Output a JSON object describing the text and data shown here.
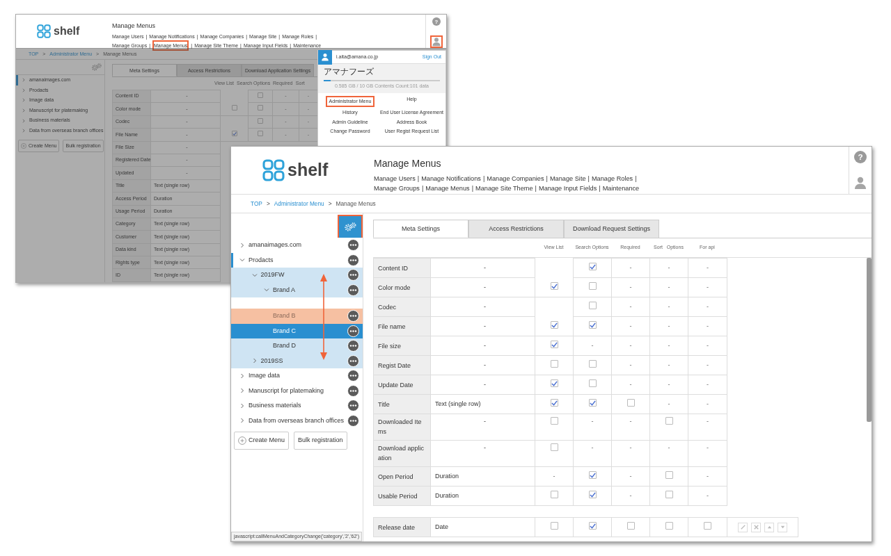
{
  "back_window": {
    "logo": "shelf",
    "title": "Manage Menus",
    "help_label": "?",
    "user_button": {
      "highlighted": true
    },
    "separator": "|",
    "nav_lines": [
      [
        {
          "label": "Manage Users",
          "highlighted": false
        },
        {
          "label": "Manage Notifications",
          "highlighted": false
        },
        {
          "label": "Manage Companies",
          "highlighted": false
        },
        {
          "label": "Manage Site",
          "highlighted": false
        },
        {
          "label": "Manage Roles",
          "highlighted": false
        }
      ],
      [
        {
          "label": "Manage Groups",
          "highlighted": false
        },
        {
          "label": "Manage Menus",
          "highlighted": true
        },
        {
          "label": "Manage Site Theme",
          "highlighted": false
        },
        {
          "label": "Manage Input Fields",
          "highlighted": false
        },
        {
          "label": "Maintenance",
          "highlighted": false
        }
      ]
    ],
    "breadcrumb_separator": ">",
    "breadcrumb": [
      {
        "label": "TOP",
        "link": true
      },
      {
        "label": "Administrator Menu",
        "link": true
      },
      {
        "label": "Manage Menus",
        "link": false
      }
    ],
    "dimmed": true,
    "tree": [
      {
        "label": "amanaimages.com",
        "selected": true
      },
      {
        "label": "Prodacts",
        "selected": false
      },
      {
        "label": "Image data",
        "selected": false
      },
      {
        "label": "Manuscript for platemaking",
        "selected": false
      },
      {
        "label": "Business materials",
        "selected": false
      },
      {
        "label": "Data from overseas branch offices",
        "selected": false
      }
    ],
    "buttons": [
      {
        "label": "Create Menu",
        "kind": "add"
      },
      {
        "label": "Bulk registration",
        "kind": "plain"
      }
    ],
    "tabs": [
      {
        "label": "Meta Settings",
        "selected": true
      },
      {
        "label": "Access Restrictions",
        "selected": false
      },
      {
        "label": "Download Application Settings",
        "selected": false
      }
    ],
    "columns": [
      "View List",
      "Search Options",
      "Required",
      "Sort"
    ],
    "rows": [
      {
        "label": "Content ID",
        "type": "-",
        "cells": [
          {
            "kind": "empty"
          },
          {
            "kind": "check",
            "checked": false
          },
          {
            "kind": "dash",
            "text": "-"
          },
          {
            "kind": "dash",
            "text": "-"
          }
        ]
      },
      {
        "label": "Color mode",
        "type": "-",
        "cells": [
          {
            "kind": "check",
            "checked": false
          },
          {
            "kind": "check",
            "checked": false
          },
          {
            "kind": "dash",
            "text": "-"
          },
          {
            "kind": "dash",
            "text": "-"
          }
        ]
      },
      {
        "label": "Codec",
        "type": "-",
        "cells": [
          {
            "kind": "empty"
          },
          {
            "kind": "check",
            "checked": false
          },
          {
            "kind": "dash",
            "text": "-"
          },
          {
            "kind": "dash",
            "text": "-"
          }
        ]
      },
      {
        "label": "File Name",
        "type": "-",
        "cells": [
          {
            "kind": "check",
            "checked": true
          },
          {
            "kind": "check",
            "checked": false
          },
          {
            "kind": "dash",
            "text": "-"
          },
          {
            "kind": "dash",
            "text": "-"
          }
        ]
      },
      {
        "label": "File Size",
        "type": "-",
        "cells": []
      },
      {
        "label": "Registered Date",
        "type": "-",
        "cells": []
      },
      {
        "label": "Updated",
        "type": "-",
        "cells": []
      },
      {
        "label": "Title",
        "type": "Text (single row)",
        "cells": []
      },
      {
        "label": "Access Period",
        "type": "Duration",
        "cells": []
      },
      {
        "label": "Usage Period",
        "type": "Duration",
        "cells": []
      },
      {
        "label": "Category",
        "type": "Text (single row)",
        "cells": []
      },
      {
        "label": "Customer",
        "type": "Text (single row)",
        "cells": []
      },
      {
        "label": "Data kind",
        "type": "Text (single row)",
        "cells": []
      },
      {
        "label": "Rights type",
        "type": "Text (single row)",
        "cells": []
      },
      {
        "label": "ID",
        "type": "Text (single row)",
        "cells": []
      }
    ],
    "user_menu": {
      "email": "i.aita@amana.co.jp",
      "sign_out": "Sign Out",
      "organization": "アマナフーズ",
      "storage": {
        "level": 0.06
      },
      "usage": "0.585 GB / 10 GB  Contents Count:101  data",
      "links": [
        {
          "label": "Administrator Menu",
          "highlighted": true
        },
        {
          "label": "Help",
          "highlighted": false
        },
        {
          "label": "History",
          "highlighted": false
        },
        {
          "label": "End User License Agreement",
          "highlighted": false
        },
        {
          "label": "Admin Guideline",
          "highlighted": false
        },
        {
          "label": "Address Book",
          "highlighted": false
        },
        {
          "label": "Change Password",
          "highlighted": false
        },
        {
          "label": "User Regist Request List",
          "highlighted": false
        }
      ]
    }
  },
  "front_window": {
    "logo": "shelf",
    "title": "Manage Menus",
    "help_label": "?",
    "separator": "|",
    "nav_lines": [
      [
        {
          "label": "Manage Users"
        },
        {
          "label": "Manage Notifications"
        },
        {
          "label": "Manage Companies"
        },
        {
          "label": "Manage Site"
        },
        {
          "label": "Manage Roles"
        }
      ],
      [
        {
          "label": "Manage Groups"
        },
        {
          "label": "Manage Menus"
        },
        {
          "label": "Manage Site Theme"
        },
        {
          "label": "Manage Input Fields"
        },
        {
          "label": "Maintenance"
        }
      ]
    ],
    "breadcrumb_separator": ">",
    "breadcrumb": [
      {
        "label": "TOP",
        "link": true
      },
      {
        "label": "Administrator Menu",
        "link": true
      },
      {
        "label": "Manage Menus",
        "link": false
      }
    ],
    "settings_button": {
      "highlighted": true
    },
    "drag_arrow": true,
    "tree": [
      {
        "label": "amanaimages.com",
        "kind": "branch",
        "expanded": false,
        "selected": false
      },
      {
        "label": "Prodacts",
        "kind": "branch",
        "expanded": true,
        "selected": true,
        "children": [
          {
            "label": "2019FW",
            "kind": "branch",
            "expanded": true,
            "selected": false,
            "children": [
              {
                "label": "Brand A",
                "kind": "branch",
                "expanded": true,
                "selected": false
              },
              {
                "label": "Brand B",
                "kind": "dragging",
                "selected": false
              },
              {
                "label": "Brand C",
                "kind": "leaf",
                "selected": true
              },
              {
                "label": "Brand D",
                "kind": "leaf",
                "selected": false
              }
            ]
          },
          {
            "label": "2019SS",
            "kind": "branch",
            "expanded": false,
            "selected": false
          }
        ]
      },
      {
        "label": "Image data",
        "kind": "branch",
        "expanded": false,
        "selected": false
      },
      {
        "label": "Manuscript for platemaking",
        "kind": "branch",
        "expanded": false,
        "selected": false
      },
      {
        "label": "Business materials",
        "kind": "branch",
        "expanded": false,
        "selected": false
      },
      {
        "label": "Data from overseas branch offices",
        "kind": "branch",
        "expanded": false,
        "selected": false
      }
    ],
    "buttons": [
      {
        "label": "Create Menu",
        "kind": "add"
      },
      {
        "label": "Bulk registration",
        "kind": "plain"
      }
    ],
    "tabs": [
      {
        "label": "Meta Settings",
        "selected": true
      },
      {
        "label": "Access Restrictions",
        "selected": false
      },
      {
        "label": "Download Request Settings",
        "selected": false
      }
    ],
    "columns": [
      "View List",
      "Search Options",
      "Required",
      "Sort   Options",
      "For api"
    ],
    "rows": [
      {
        "label": "Content ID",
        "type": "-",
        "cells": [
          {
            "kind": "empty"
          },
          {
            "kind": "check",
            "checked": true
          },
          {
            "kind": "dash",
            "text": "-"
          },
          {
            "kind": "dash",
            "text": "-"
          },
          {
            "kind": "dash",
            "text": "-"
          }
        ]
      },
      {
        "label": "Color mode",
        "type": "-",
        "cells": [
          {
            "kind": "check",
            "checked": true
          },
          {
            "kind": "check",
            "checked": false
          },
          {
            "kind": "dash",
            "text": "-"
          },
          {
            "kind": "dash",
            "text": "-"
          },
          {
            "kind": "dash",
            "text": "-"
          }
        ]
      },
      {
        "label": "Codec",
        "type": "-",
        "cells": [
          {
            "kind": "empty"
          },
          {
            "kind": "check",
            "checked": false
          },
          {
            "kind": "dash",
            "text": "-"
          },
          {
            "kind": "dash",
            "text": "-"
          },
          {
            "kind": "dash",
            "text": "-"
          }
        ]
      },
      {
        "label": "File name",
        "type": "-",
        "cells": [
          {
            "kind": "check",
            "checked": true
          },
          {
            "kind": "check",
            "checked": true
          },
          {
            "kind": "dash",
            "text": "-"
          },
          {
            "kind": "dash",
            "text": "-"
          },
          {
            "kind": "dash",
            "text": "-"
          }
        ]
      },
      {
        "label": "File size",
        "type": "-",
        "cells": [
          {
            "kind": "check",
            "checked": true
          },
          {
            "kind": "dash",
            "text": "-"
          },
          {
            "kind": "dash",
            "text": "-"
          },
          {
            "kind": "dash",
            "text": "-"
          },
          {
            "kind": "dash",
            "text": "-"
          }
        ]
      },
      {
        "label": "Regist Date",
        "type": "-",
        "cells": [
          {
            "kind": "check",
            "checked": false
          },
          {
            "kind": "check",
            "checked": false
          },
          {
            "kind": "dash",
            "text": "-"
          },
          {
            "kind": "dash",
            "text": "-"
          },
          {
            "kind": "dash",
            "text": "-"
          }
        ]
      },
      {
        "label": "Update Date",
        "type": "-",
        "cells": [
          {
            "kind": "check",
            "checked": true
          },
          {
            "kind": "check",
            "checked": false
          },
          {
            "kind": "dash",
            "text": "-"
          },
          {
            "kind": "dash",
            "text": "-"
          },
          {
            "kind": "dash",
            "text": "-"
          }
        ]
      },
      {
        "label": "Title",
        "type": "Text (single row)",
        "cells": [
          {
            "kind": "check",
            "checked": true
          },
          {
            "kind": "check",
            "checked": true
          },
          {
            "kind": "check",
            "checked": false
          },
          {
            "kind": "dash",
            "text": "-"
          },
          {
            "kind": "dash",
            "text": "-"
          }
        ]
      },
      {
        "label": "Downloaded Ite ms",
        "type": "-",
        "cells": [
          {
            "kind": "check",
            "checked": false
          },
          {
            "kind": "dash",
            "text": "-"
          },
          {
            "kind": "dash",
            "text": "-"
          },
          {
            "kind": "check",
            "checked": false
          },
          {
            "kind": "dash",
            "text": "-"
          }
        ]
      },
      {
        "label": "Download applic ation",
        "type": "-",
        "cells": [
          {
            "kind": "check",
            "checked": false
          },
          {
            "kind": "dash",
            "text": "-"
          },
          {
            "kind": "dash",
            "text": "-"
          },
          {
            "kind": "dash",
            "text": "-"
          },
          {
            "kind": "dash",
            "text": "-"
          }
        ]
      },
      {
        "label": "Open Period",
        "type": "Duration",
        "cells": [
          {
            "kind": "dash",
            "text": "-"
          },
          {
            "kind": "check",
            "checked": true
          },
          {
            "kind": "dash",
            "text": "-"
          },
          {
            "kind": "check",
            "checked": false
          },
          {
            "kind": "dash",
            "text": "-"
          }
        ]
      },
      {
        "label": "Usable Period",
        "type": "Duration",
        "cells": [
          {
            "kind": "check",
            "checked": false
          },
          {
            "kind": "check",
            "checked": true
          },
          {
            "kind": "dash",
            "text": "-"
          },
          {
            "kind": "check",
            "checked": false
          },
          {
            "kind": "dash",
            "text": "-"
          }
        ]
      }
    ],
    "custom_rows": [
      {
        "label": "Release date",
        "type": "Date",
        "cells": [
          {
            "kind": "check",
            "checked": false
          },
          {
            "kind": "check",
            "checked": true
          },
          {
            "kind": "check",
            "checked": false
          },
          {
            "kind": "check",
            "checked": false
          },
          {
            "kind": "check",
            "checked": false
          }
        ],
        "actions": [
          {
            "kind": "edit"
          },
          {
            "kind": "delete"
          },
          {
            "kind": "up"
          },
          {
            "kind": "down"
          }
        ]
      }
    ],
    "status_bar": "javascript:callMenuAndCategoryChange('category','2','62')"
  }
}
